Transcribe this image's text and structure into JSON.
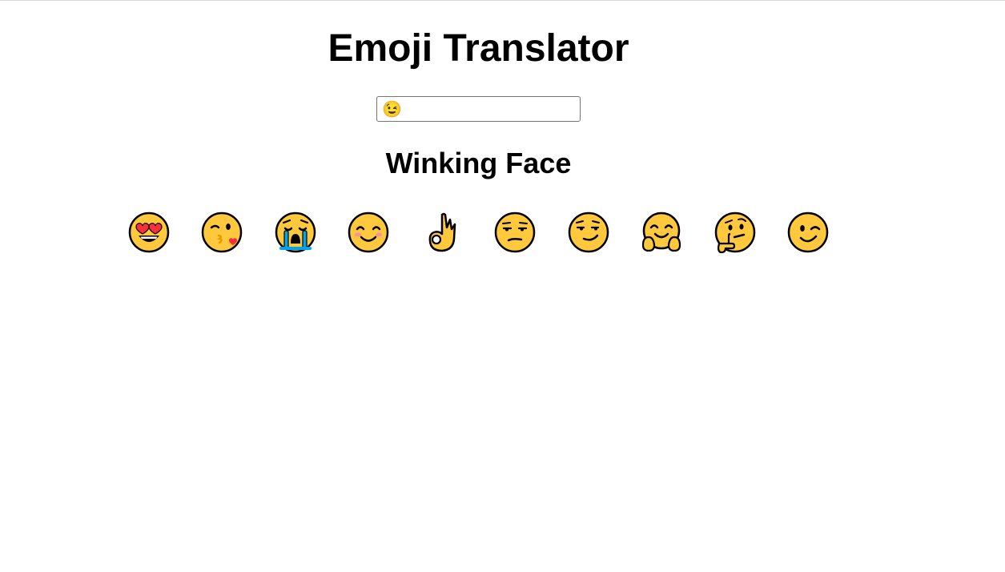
{
  "app": {
    "title": "Emoji Translator"
  },
  "search": {
    "value": "😉"
  },
  "result": {
    "meaning": "Winking Face"
  },
  "emojis": [
    {
      "char": "😍",
      "icon": "smiling-face-with-heart-eyes-icon"
    },
    {
      "char": "😘",
      "icon": "face-blowing-a-kiss-icon"
    },
    {
      "char": "😭",
      "icon": "loudly-crying-face-icon"
    },
    {
      "char": "😊",
      "icon": "smiling-face-with-smiling-eyes-icon"
    },
    {
      "char": "👌",
      "icon": "ok-hand-icon"
    },
    {
      "char": "😒",
      "icon": "unamused-face-icon"
    },
    {
      "char": "😏",
      "icon": "smirking-face-icon"
    },
    {
      "char": "🤗",
      "icon": "hugging-face-icon"
    },
    {
      "char": "🤔",
      "icon": "thinking-face-icon"
    },
    {
      "char": "😉",
      "icon": "winking-face-icon"
    }
  ],
  "colors": {
    "face": "#FFC83D",
    "outline": "#000000",
    "heart": "#F92F3C",
    "tear": "#00A6ED",
    "blush": "#FF8FA0"
  }
}
